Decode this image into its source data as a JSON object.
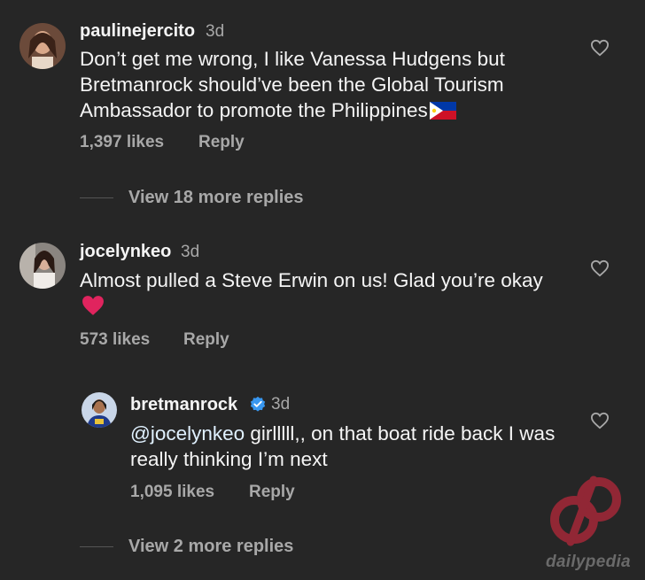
{
  "comments": [
    {
      "username": "paulinejercito",
      "time": "3d",
      "text": "Don’t get me wrong, I like Vanessa Hudgens but Bretmanrock should’ve been the Global Tourism Ambassador to promote the Philippines",
      "flag_emoji": "philippines-flag",
      "likes": "1,397 likes",
      "reply": "Reply",
      "view_replies": "View 18 more replies"
    },
    {
      "username": "jocelynkeo",
      "time": "3d",
      "text": "Almost pulled a Steve Erwin on us! Glad you’re okay",
      "emoji": "red-heart",
      "likes": "573 likes",
      "reply": "Reply"
    }
  ],
  "reply": {
    "username": "bretmanrock",
    "verified": true,
    "time": "3d",
    "mention": "@jocelynkeo",
    "text": " girlllll,, on that boat ride back I was really thinking I’m next",
    "likes": "1,095 likes",
    "reply": "Reply",
    "view_replies": "View 2 more replies"
  },
  "watermark": {
    "text": "dailypedia"
  },
  "colors": {
    "background": "#262626",
    "secondary_text": "#a8a8a8",
    "verified_blue": "#3897f0",
    "heart_red": "#e0245e"
  }
}
